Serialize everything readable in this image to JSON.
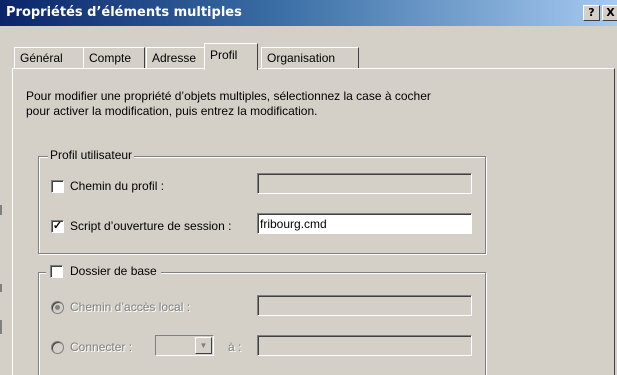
{
  "window": {
    "title": "Propriétés d’éléments multiples",
    "help_button": "?",
    "close_button": "X"
  },
  "tabs": [
    {
      "label": "Général"
    },
    {
      "label": "Compte"
    },
    {
      "label": "Adresse"
    },
    {
      "label": "Profil",
      "active": true
    },
    {
      "label": "Organisation"
    }
  ],
  "description": {
    "line1": "Pour modifier une propriété d’objets multiples, sélectionnez la case à cocher",
    "line2": "pour activer la modification, puis entrez la modification."
  },
  "profile_group": {
    "legend": "Profil utilisateur",
    "profile_path": {
      "label": "Chemin du profil :",
      "checked": false,
      "value": ""
    },
    "logon_script": {
      "label": "Script d’ouverture de session :",
      "checked": true,
      "value": "fribourg.cmd"
    }
  },
  "home_group": {
    "legend": "Dossier de base",
    "checked": false,
    "local_path": {
      "label": "Chemin d’accès local :",
      "selected": true,
      "value": ""
    },
    "connect": {
      "label": "Connecter :",
      "selected": false,
      "drive": "",
      "to_label": "à :",
      "value": ""
    }
  }
}
